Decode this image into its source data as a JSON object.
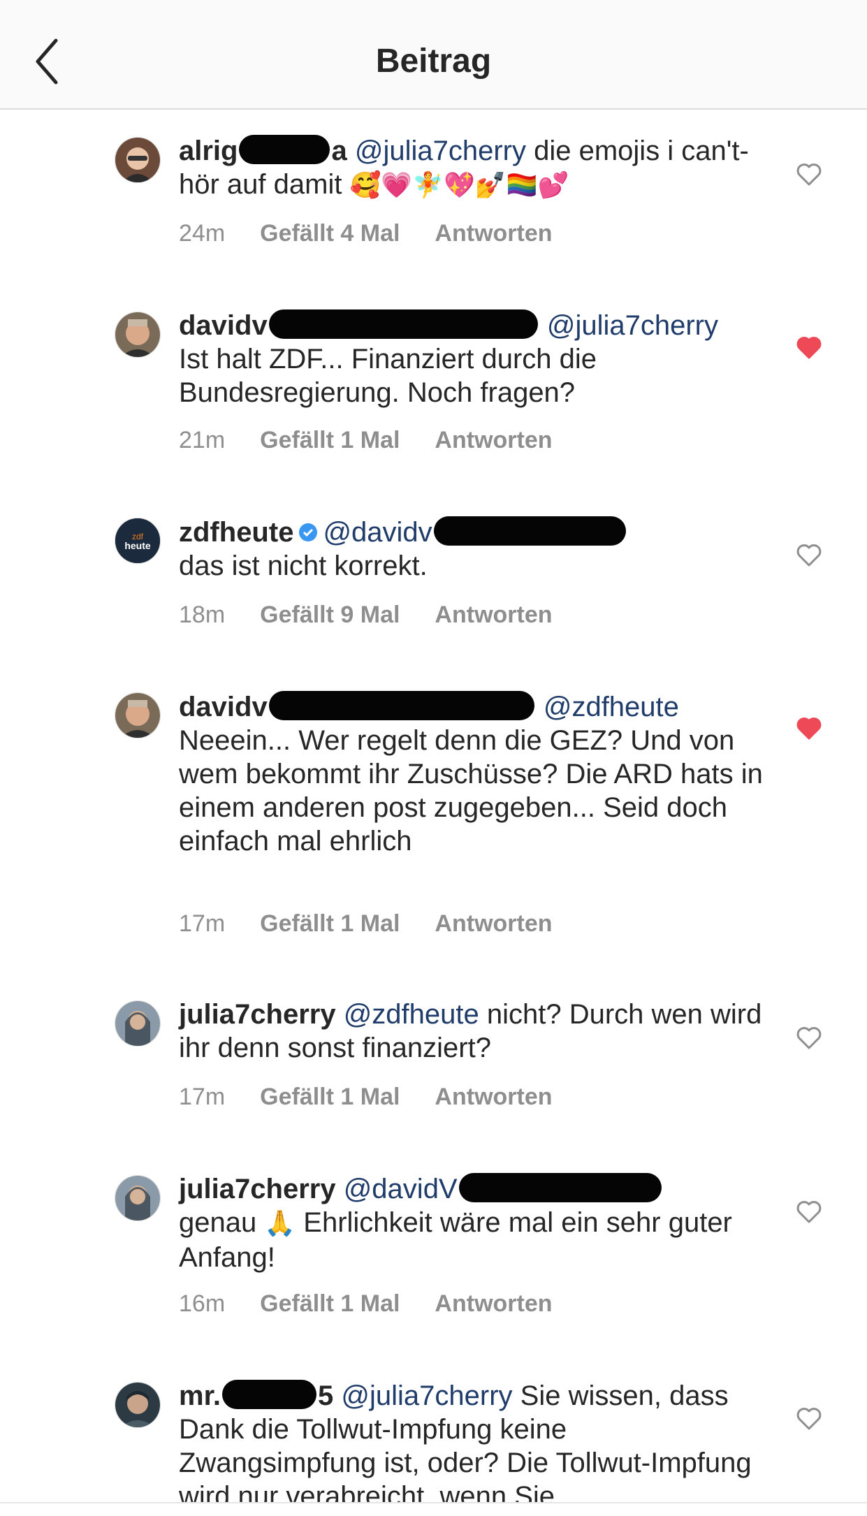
{
  "header": {
    "title": "Beitrag"
  },
  "comments": [
    {
      "user": "alrig",
      "user_suffix": "a",
      "mention": "@julia7cherry",
      "text": " die emojis i can't- hör auf damit ",
      "emojis": "🥰💗🧚💖💅🏳️‍🌈💕",
      "time": "24m",
      "likes": "Gefällt 4 Mal",
      "reply": "Antworten",
      "liked": false
    },
    {
      "user": "davidv",
      "mention": "@julia7cherry",
      "text": "Ist halt ZDF... Finanziert durch die Bundesregierung. Noch fragen?",
      "time": "21m",
      "likes": "Gefällt 1 Mal",
      "reply": "Antworten",
      "liked": true
    },
    {
      "user": "zdfheute",
      "mention": "@davidv",
      "text": "das ist nicht korrekt.",
      "avatar_top": "zdf",
      "avatar_bottom": "heute",
      "time": "18m",
      "likes": "Gefällt 9 Mal",
      "reply": "Antworten",
      "liked": false
    },
    {
      "user": "davidv",
      "mention": "@zdfheute",
      "text": "Neeein... Wer regelt denn die GEZ? Und von wem bekommt ihr Zuschüsse? Die ARD hats in einem anderen post zugegeben... Seid doch einfach mal ehrlich",
      "time": "17m",
      "likes": "Gefällt 1 Mal",
      "reply": "Antworten",
      "liked": true
    },
    {
      "user": "julia7cherry",
      "mention": "@zdfheute",
      "text": " nicht? Durch wen wird ihr denn sonst finanziert?",
      "time": "17m",
      "likes": "Gefällt 1 Mal",
      "reply": "Antworten",
      "liked": false
    },
    {
      "user": "julia7cherry",
      "mention": "@davidV",
      "text_before": "genau ",
      "emoji": "🙏",
      "text": " Ehrlichkeit wäre mal ein sehr guter Anfang!",
      "time": "16m",
      "likes": "Gefällt 1 Mal",
      "reply": "Antworten",
      "liked": false
    },
    {
      "user": "mr.",
      "user_suffix": "5",
      "mention": "@julia7cherry",
      "text": " Sie wissen, dass Dank die Tollwut-Impfung keine Zwangsimpfung ist, oder? Die Tollwut-Impfung wird nur verabreicht, wenn Sie",
      "liked": false
    }
  ],
  "colors": {
    "heart_liked": "#ed4956",
    "heart_outline": "#8e8e8e",
    "verified": "#3897f0",
    "mention": "#1f3c6b"
  }
}
